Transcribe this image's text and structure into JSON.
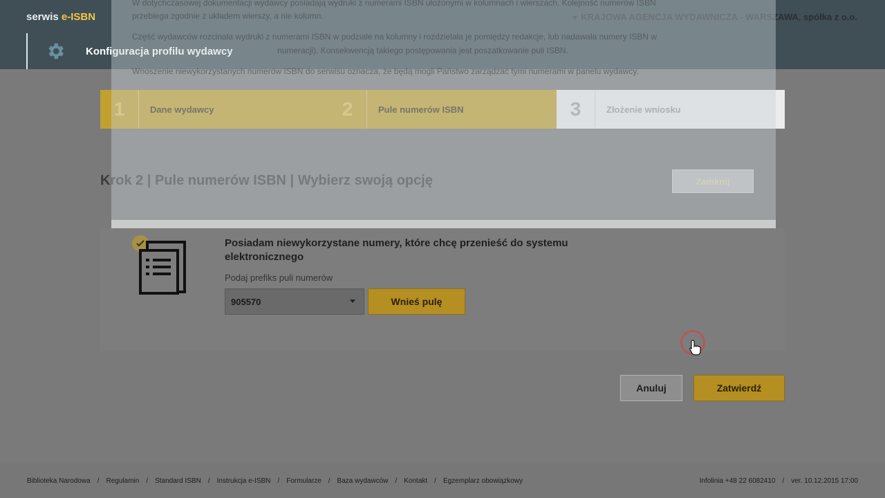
{
  "header": {
    "brand_prefix": "serwis ",
    "brand_highlight": "e-ISBN",
    "page_title": "Konfiguracja profilu wydawcy",
    "publisher": "KRAJOWA AGENCJA WYDAWNICZA - WARSZAWA, spółka z o.o."
  },
  "ghost_dialog": {
    "line1": "W dotychczasowej dokumentacji wydawcy posiadają wydruki z numerami ISBN ułożonymi w kolumnach i wierszach. Kolejność numerów ISBN",
    "line2": "przebiega zgodnie z układem wierszy, a nie kolumn.",
    "line3": "Część wydawców rozcinała wydruki z numerami ISBN w podziale na kolumny i rozdzielała je pomiędzy redakcje, lub nadawała numery ISBN w",
    "line4": "numeracji). Konsekwencją takiego postępowania jest poszatkowanie puli ISBN.",
    "line5": "Wnoszenie niewykorzystanych numerów ISBN do serwisu oznacza, że będą mogli Państwo zarządzać tymi numerami w panelu wydawcy."
  },
  "steps": [
    {
      "num": "1",
      "label": "Dane wydawcy"
    },
    {
      "num": "2",
      "label": "Pule numerów ISBN"
    },
    {
      "num": "3",
      "label": "Złożenie wniosku"
    }
  ],
  "step_heading": "Krok 2 | Pule numerów ISBN | Wybierz swoją opcję",
  "close_button": "Zamknij",
  "option": {
    "title": "Posiadam niewykorzystane numery, które chcę przenieść do systemu elektronicznego",
    "prefix_label": "Podaj prefiks puli numerów",
    "prefix_value": "905570",
    "add_button": "Wnieś pulę"
  },
  "actions": {
    "cancel": "Anuluj",
    "submit": "Zatwierdź"
  },
  "footer": {
    "links": [
      "Biblioteka Narodowa",
      "Regulamin",
      "Standard ISBN",
      "Instrukcja e-ISBN",
      "Formularze",
      "Baza wydawców",
      "Kontakt",
      "Egzemplarz obowiązkowy"
    ],
    "hotline": "Infolinia +48 22 6082410",
    "version": "ver. 10.12.2015 17:00"
  },
  "colors": {
    "accent": "#b58f22",
    "header_bg": "#3f4f55",
    "brand_highlight": "#f3c34a"
  }
}
